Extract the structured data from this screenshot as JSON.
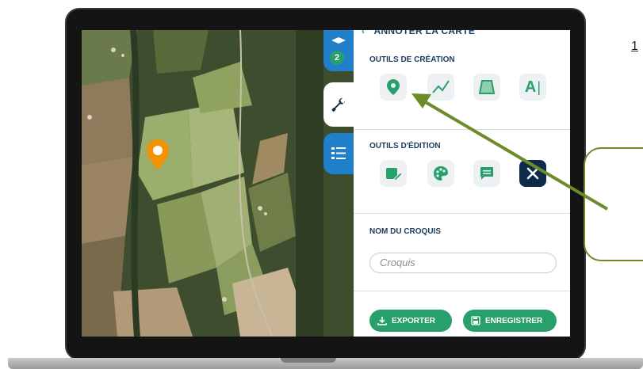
{
  "panel": {
    "header": "ANNOTER LA CARTE",
    "creation_title": "OUTILS DE CRÉATION",
    "edition_title": "OUTILS D'ÉDITION",
    "sketch_name_title": "NOM DU CROQUIS",
    "sketch_name_placeholder": "Croquis",
    "export_label": "EXPORTER",
    "save_label": "ENREGISTRER",
    "text_tool_glyph": "A"
  },
  "tabs": {
    "layers_badge": "2"
  },
  "annotation": {
    "step_label": "1"
  },
  "colors": {
    "accent_green": "#27a06b",
    "tab_blue": "#1f7fc9",
    "navy": "#0e2a4a",
    "marker_orange": "#f39200",
    "arrow_olive": "#6e8b2a"
  },
  "icons": {
    "creation": [
      "map-pin-icon",
      "polyline-icon",
      "polygon-icon",
      "text-icon"
    ],
    "edition": [
      "edit-icon",
      "palette-icon",
      "comment-icon",
      "close-icon"
    ],
    "tabs": [
      "layers-icon",
      "wrench-icon",
      "legend-list-icon"
    ]
  }
}
